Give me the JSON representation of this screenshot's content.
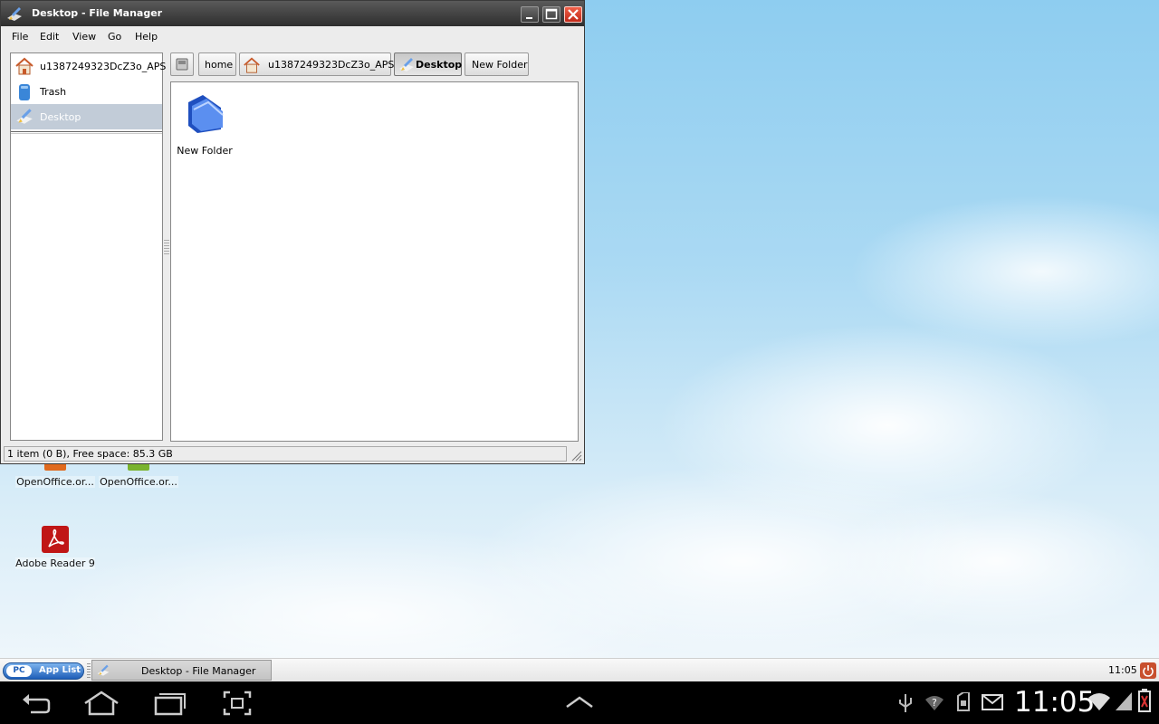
{
  "window": {
    "title": "Desktop - File Manager",
    "menu": [
      "File",
      "Edit",
      "View",
      "Go",
      "Help"
    ]
  },
  "sidebar": {
    "items": [
      {
        "label": "u1387249323DcZ3o_APS",
        "icon": "home-folder-icon"
      },
      {
        "label": "Trash",
        "icon": "trash-icon"
      },
      {
        "label": "Desktop",
        "icon": "desktop-icon",
        "selected": true
      }
    ]
  },
  "pathbar": {
    "items": [
      "home",
      "u1387249323DcZ3o_APS",
      "Desktop",
      "New Folder"
    ],
    "active": "Desktop"
  },
  "files": [
    {
      "name": "New Folder",
      "icon": "folder-icon"
    }
  ],
  "status": {
    "text": "1 item (0 B), Free space: 85.3 GB"
  },
  "desktop_icons": [
    {
      "label": "OpenOffice.or...",
      "icon": "openoffice-icon"
    },
    {
      "label": "OpenOffice.or...",
      "icon": "openoffice-icon"
    },
    {
      "label": "Adobe Reader 9",
      "icon": "adobe-reader-icon"
    }
  ],
  "taskbar": {
    "app_list_pc": "PC",
    "app_list_label": "App List",
    "task_label": "Desktop - File Manager",
    "clock": "11:05"
  },
  "navbar": {
    "clock": "11:05"
  },
  "colors": {
    "selection": "#c2ccd8",
    "close_button": "#d23a22",
    "applist_blue": "#1f5fb8"
  }
}
